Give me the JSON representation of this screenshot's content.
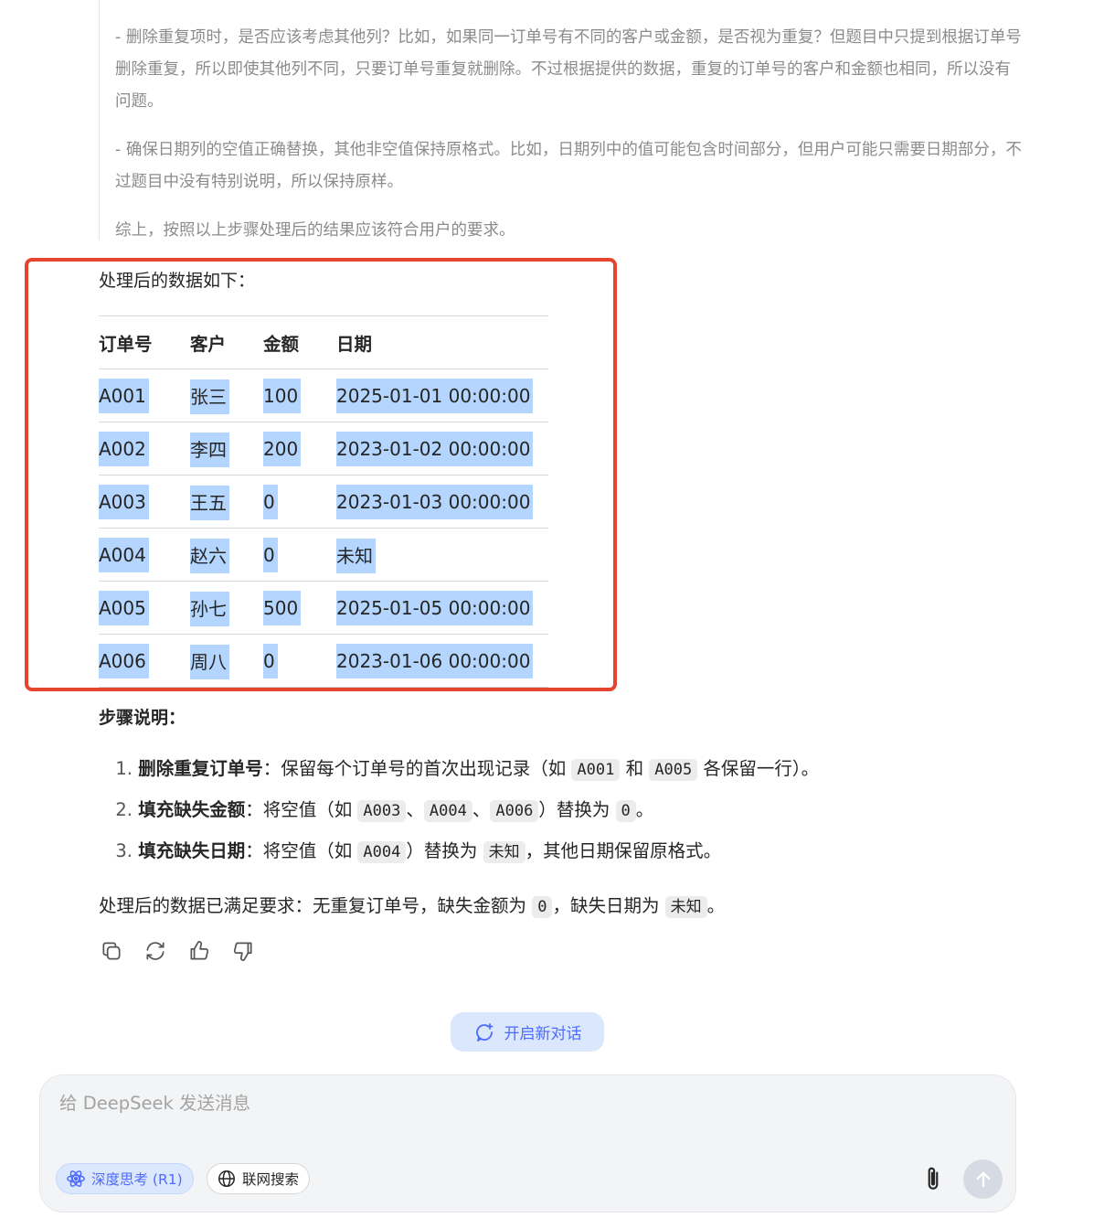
{
  "thinking": {
    "p1": "- 删除重复项时，是否应该考虑其他列？比如，如果同一订单号有不同的客户或金额，是否视为重复？但题目中只提到根据订单号删除重复，所以即使其他列不同，只要订单号重复就删除。不过根据提供的数据，重复的订单号的客户和金额也相同，所以没有问题。",
    "p2": "- 确保日期列的空值正确替换，其他非空值保持原格式。比如，日期列中的值可能包含时间部分，但用户可能只需要日期部分，不过题目中没有特别说明，所以保持原样。",
    "p3": "综上，按照以上步骤处理后的结果应该符合用户的要求。"
  },
  "result": {
    "heading": "处理后的数据如下：",
    "columns": [
      "订单号",
      "客户",
      "金额",
      "日期"
    ],
    "rows": [
      [
        "A001",
        "张三",
        "100",
        "2025-01-01 00:00:00"
      ],
      [
        "A002",
        "李四",
        "200",
        "2023-01-02 00:00:00"
      ],
      [
        "A003",
        "王五",
        "0",
        "2023-01-03 00:00:00"
      ],
      [
        "A004",
        "赵六",
        "0",
        "未知"
      ],
      [
        "A005",
        "孙七",
        "500",
        "2025-01-05 00:00:00"
      ],
      [
        "A006",
        "周八",
        "0",
        "2023-01-06 00:00:00"
      ]
    ]
  },
  "steps": {
    "title": "步骤说明：",
    "items": [
      {
        "num": "1.",
        "bold": "删除重复订单号",
        "t1": "：保留每个订单号的首次出现记录（如 ",
        "c1": "A001",
        "t2": " 和 ",
        "c2": "A005",
        "t3": " 各保留一行）。"
      },
      {
        "num": "2.",
        "bold": "填充缺失金额",
        "t1": "：将空值（如 ",
        "c1": "A003",
        "t2": "、",
        "c2": "A004",
        "t3": "、",
        "c3": "A006",
        "t4": "）替换为 ",
        "c4": "0",
        "t5": "。"
      },
      {
        "num": "3.",
        "bold": "填充缺失日期",
        "t1": "：将空值（如 ",
        "c1": "A004",
        "t2": "）替换为 ",
        "c2": "未知",
        "t3": "，其他日期保留原格式。"
      }
    ]
  },
  "conclusion": {
    "t1": "处理后的数据已满足要求：无重复订单号，缺失金额为 ",
    "c1": "0",
    "t2": "，缺失日期为 ",
    "c2": "未知",
    "t3": "。"
  },
  "actions": {
    "icons": [
      "copy-icon",
      "regenerate-icon",
      "thumbs-up-icon",
      "thumbs-down-icon"
    ]
  },
  "new_chat": {
    "label": "开启新对话",
    "icon": "new-chat-icon"
  },
  "composer": {
    "placeholder": "给 DeepSeek 发送消息",
    "value": "",
    "deep_think_label": "深度思考 (R1)",
    "web_search_label": "联网搜索"
  },
  "colors": {
    "accent": "#4d6bfe",
    "highlight_border": "#e5452f",
    "selection": "#b4d5fe",
    "muted_text": "#8b8b8b"
  }
}
